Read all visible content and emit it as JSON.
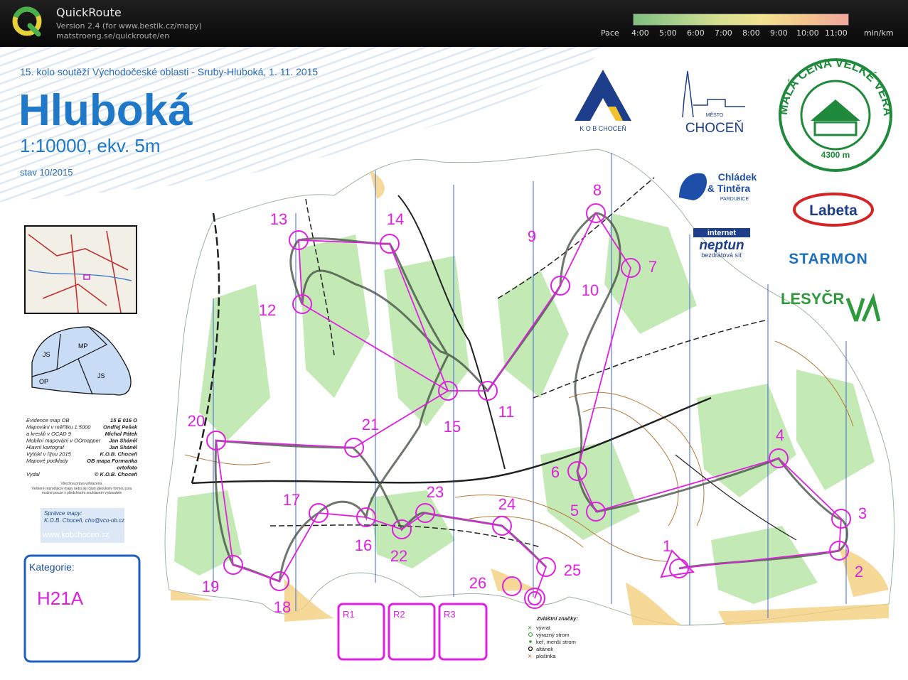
{
  "app": {
    "title": "QuickRoute",
    "version": "Version 2.4  (for www.bestik.cz/mapy)",
    "url": "matstroeng.se/quickroute/en"
  },
  "pace": {
    "label": "Pace",
    "ticks": [
      "4:00",
      "5:00",
      "6:00",
      "7:00",
      "8:00",
      "9:00",
      "10:00",
      "11:00"
    ],
    "unit": "min/km",
    "colors": [
      "#7fbf7f",
      "#d6df90",
      "#f2e28f",
      "#f2a7a0"
    ]
  },
  "map": {
    "event": "15. kolo soutěží Východočeské oblasti - Sruby-Hluboká, 1. 11. 2015",
    "name": "Hluboká",
    "scale": "1:10000, ekv. 5m",
    "status": "stav 10/2015",
    "areas": [
      "MP",
      "JS",
      "JS",
      "OP"
    ],
    "credits": [
      [
        "Evidence map OB",
        "15 E 016 O"
      ],
      [
        "Mapováni v měřítku 1:5000",
        "Ondřej Pešek"
      ],
      [
        "a kreslili v OCAD 9",
        "Michal Pátek"
      ],
      [
        "Mobilní mapování v OOmapper",
        "Jan Shánél"
      ],
      [
        "Hlavní kartograf",
        "Jan Shánél"
      ],
      [
        "Vytiskl v říjnu 2015",
        "K.O.B. Choceň"
      ],
      [
        "Mapové podklady",
        "OB mapa Formanka"
      ],
      [
        "",
        "ortofoto"
      ],
      [
        "Vydal",
        "© K.O.B. Choceň"
      ]
    ],
    "rights": "Všechna práva vyhrazena.",
    "rights2": "Veškeré reprodukce mapy nebo její části jakoukoliv formou jsou",
    "rights3": "možné pouze s předchozím souhlasem vydavatele",
    "admin_label": "Správce mapy:",
    "admin_contact": "K.O.B. Choceň, cho@vco-ob.cz",
    "admin_web": "www.kobchocen.cz",
    "category_label": "Kategorie:",
    "category": "H21A",
    "relay_boxes": [
      "R1",
      "R2",
      "R3"
    ],
    "legend_title": "Zvláštní značky:",
    "legend_items": [
      "vývrat",
      "výrazný strom",
      "keř, menší strom",
      "altánek",
      "plošinka"
    ],
    "sponsors": {
      "kob": "K O B  CHOCEŇ",
      "mesto_small": "MĚSTO",
      "mesto": "CHOCEŇ",
      "seal_top": "MALÁ CENA VELKÉ VERANDY",
      "seal_dist": "4300 m",
      "chladek1": "Chládek",
      "chladek2": "& Tintěra",
      "chladek3": "PARDUBICE",
      "labeta": "Labeta",
      "internet": "internet",
      "neptun": "neptun",
      "neptun_sub": "bezdrátová síť",
      "starmon": "STARMON",
      "lesy": "LESYČR"
    },
    "controls": [
      "1",
      "2",
      "3",
      "4",
      "5",
      "6",
      "7",
      "8",
      "9",
      "10",
      "11",
      "12",
      "13",
      "14",
      "15",
      "16",
      "17",
      "18",
      "19",
      "20",
      "21",
      "22",
      "23",
      "24",
      "25",
      "26"
    ],
    "course_color": "#e020e0",
    "route_color": "#3e4a3e"
  }
}
